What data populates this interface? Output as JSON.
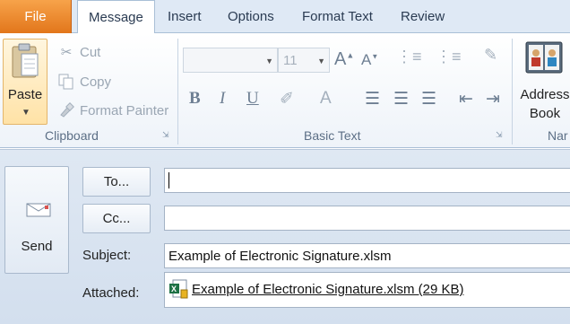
{
  "tabs": {
    "file": "File",
    "items": [
      "Message",
      "Insert",
      "Options",
      "Format Text",
      "Review"
    ],
    "active": "Message"
  },
  "ribbon": {
    "clipboard": {
      "paste": "Paste",
      "cut": "Cut",
      "copy": "Copy",
      "format_painter": "Format Painter",
      "label": "Clipboard"
    },
    "basic_text": {
      "font_name": "",
      "font_size": "11",
      "bold": "B",
      "italic": "I",
      "underline": "U",
      "label": "Basic Text"
    },
    "names": {
      "address_book_line1": "Address",
      "address_book_line2": "Book",
      "label": "Nar"
    }
  },
  "message": {
    "send": "Send",
    "to_button": "To...",
    "cc_button": "Cc...",
    "to_value": "",
    "cc_value": "",
    "subject_label": "Subject:",
    "subject_value": "Example of Electronic Signature.xlsm",
    "attached_label": "Attached:",
    "attachment": "Example of Electronic Signature.xlsm (29 KB)"
  },
  "colors": {
    "file_tab": "#e2761b",
    "tab_strip": "#dfe9f5",
    "message_bg": "#d3dfee"
  }
}
